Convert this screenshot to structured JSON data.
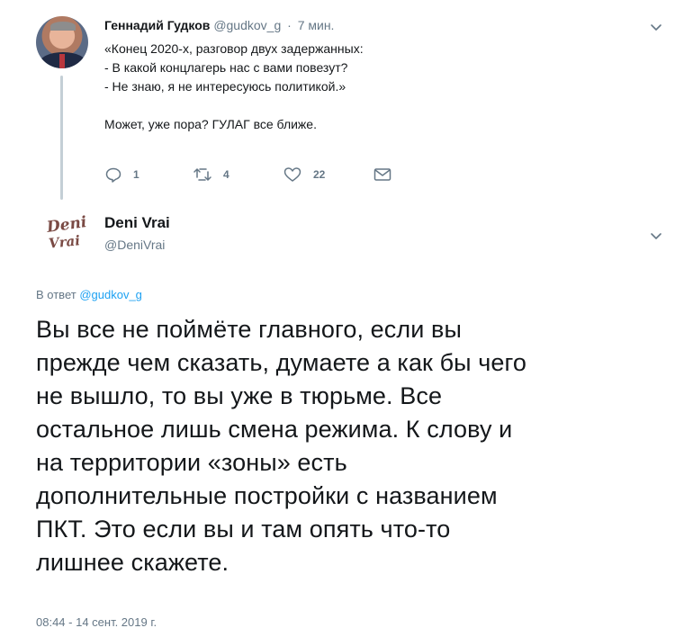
{
  "parent_tweet": {
    "author_name": "Геннадий Гудков",
    "author_handle": "@gudkov_g",
    "separator": "·",
    "time": "7 мин.",
    "lines": [
      "«Конец 2020-х, разговор двух задержанных:",
      "- В какой концлагерь нас с вами повезут?",
      "- Не знаю, я не интересуюсь политикой.»",
      "",
      "Может, уже пора? ГУЛАГ все ближе."
    ],
    "actions": {
      "reply_count": "1",
      "retweet_count": "4",
      "like_count": "22"
    },
    "icons": [
      "reply-icon",
      "retweet-icon",
      "like-icon",
      "direct-message-icon",
      "chevron-down-icon"
    ]
  },
  "reply_tweet": {
    "avatar_text_line1": "Deni",
    "avatar_text_line2": "Vrai",
    "author_name": "Deni Vrai",
    "author_handle": "@DeniVrai",
    "reply_prefix": "В ответ",
    "reply_to_handle": "@gudkov_g",
    "lines": [
      "Вы все не поймёте главного, если вы",
      "прежде чем сказать, думаете а как бы чего",
      "не вышло, то вы уже в тюрьме. Все",
      "остальное лишь смена режима. К слову и",
      "на территории «зоны» есть",
      "дополнительные постройки с названием",
      "ПКТ. Это если вы и там опять что-то",
      "лишнее скажете."
    ],
    "timestamp": "08:44 - 14 сент. 2019 г."
  },
  "colors": {
    "text": "#14171a",
    "secondary": "#657786",
    "link": "#1da1f2",
    "thread_line": "#c4cfd6"
  }
}
